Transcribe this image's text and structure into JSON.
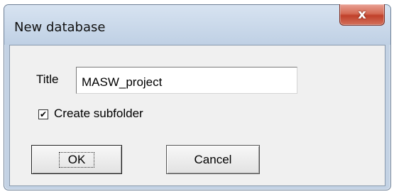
{
  "window": {
    "title": "New database",
    "close_label": "x"
  },
  "form": {
    "title_label": "Title",
    "title_value": "MASW_project",
    "create_subfolder_label": "Create subfolder",
    "create_subfolder_checked": true,
    "checkbox_mark": "✔"
  },
  "buttons": {
    "ok_label": "OK",
    "cancel_label": "Cancel"
  },
  "colors": {
    "frame": "#c3d2e4",
    "close_button": "#c0402a",
    "client_background": "#f0f0f0"
  }
}
